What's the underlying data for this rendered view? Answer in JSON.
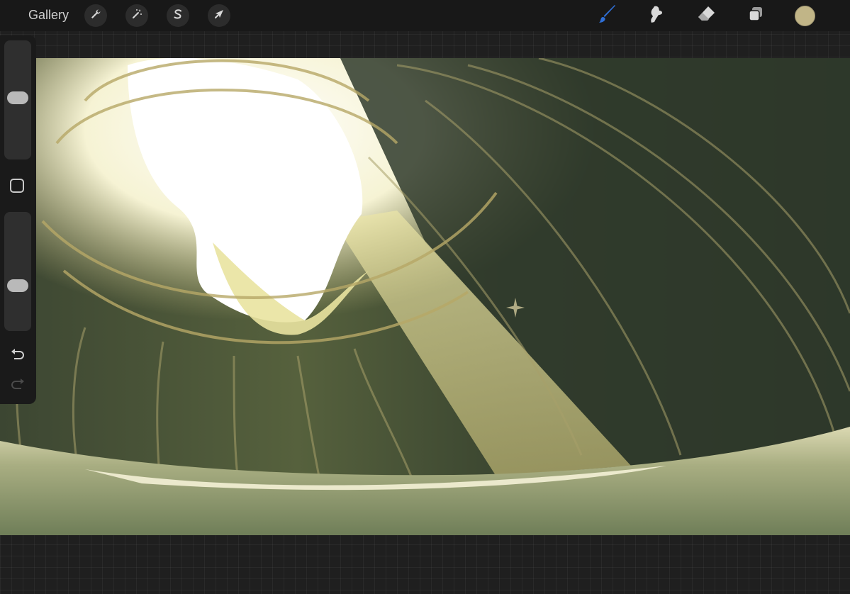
{
  "toolbar": {
    "gallery_label": "Gallery",
    "left_tools": [
      {
        "name": "wrench-icon",
        "role": "actions"
      },
      {
        "name": "magic-wand-icon",
        "role": "adjustments"
      },
      {
        "name": "selection-s-icon",
        "role": "selection"
      },
      {
        "name": "arrow-cursor-icon",
        "role": "transform"
      }
    ],
    "right_tools": [
      {
        "name": "brush-icon",
        "role": "paint",
        "active": true
      },
      {
        "name": "smudge-icon",
        "role": "smudge"
      },
      {
        "name": "eraser-icon",
        "role": "erase"
      },
      {
        "name": "layers-icon",
        "role": "layers"
      }
    ],
    "active_tool_color": "#2f6fd6",
    "current_color": "#c1b587"
  },
  "sidebar": {
    "brush_size_level": 0.52,
    "opacity_level": 0.36,
    "icons": [
      "square-modify-icon",
      "undo-icon",
      "redo-icon"
    ]
  },
  "canvas": {
    "palette": {
      "dark": "#2b3424",
      "mid": "#55623f",
      "light": "#c9bf7e",
      "highlight": "#ffffff",
      "floor": "#6f7e58"
    }
  }
}
